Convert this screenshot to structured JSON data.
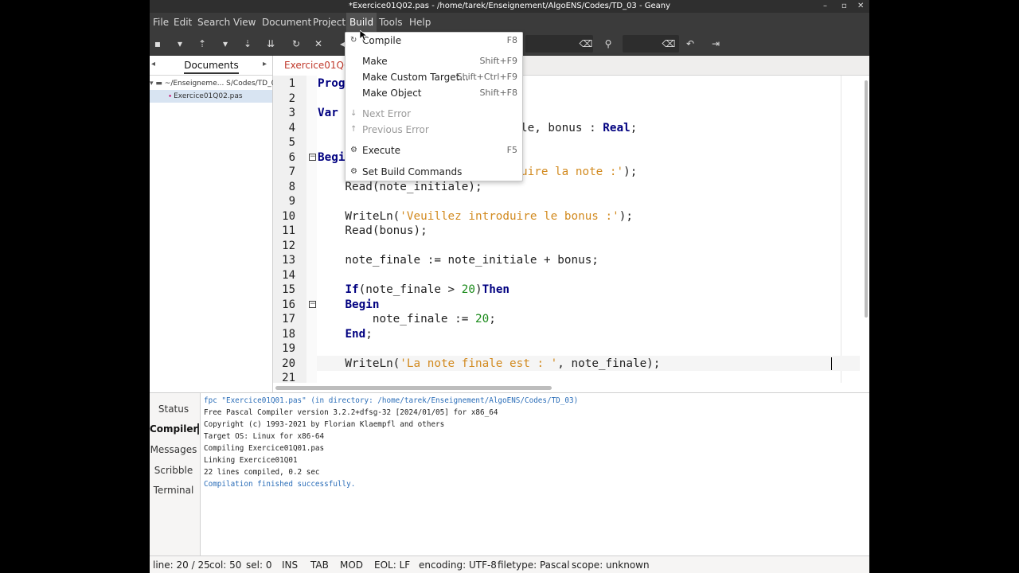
{
  "window": {
    "title": "*Exercice01Q02.pas - /home/tarek/Enseignement/AlgoENS/Codes/TD_03 - Geany",
    "controls": [
      "–",
      "▫",
      "✕"
    ]
  },
  "menubar": [
    "File",
    "Edit",
    "Search",
    "View",
    "Document",
    "Project",
    "Build",
    "Tools",
    "Help"
  ],
  "sidebar": {
    "tab_label": "Documents",
    "tree": {
      "folder": "~/Enseigneme... S/Codes/TD_03",
      "file": "Exercice01Q02.pas"
    }
  },
  "editor": {
    "tab_label": "Exercice01Q02",
    "line_numbers": [
      "1",
      "2",
      "3",
      "4",
      "5",
      "6",
      "7",
      "8",
      "9",
      "10",
      "11",
      "12",
      "13",
      "14",
      "15",
      "16",
      "17",
      "18",
      "19",
      "20",
      "21"
    ],
    "lines": {
      "l1": "Prog",
      "l3": "Var",
      "l4": "le, bonus : ",
      "l4_kw": "Real",
      "l4_end": ";",
      "l6": "Begi",
      "l7": "uire la note :'",
      "l7_end": ");",
      "l8": "    Read(note_initiale);",
      "l10_a": "    WriteLn(",
      "l10_s": "'Veuillez introduire le bonus :'",
      "l10_b": ");",
      "l11": "    Read(bonus);",
      "l13": "    note_finale := note_initiale + bonus;",
      "l15_pad": "    ",
      "l15_kw1": "If",
      "l15_a": "(note_finale > ",
      "l15_n": "20",
      "l15_b": ")",
      "l15_kw2": "Then",
      "l16_pad": "    ",
      "l16_kw": "Begin",
      "l17_a": "        note_finale := ",
      "l17_n": "20",
      "l17_b": ";",
      "l18_pad": "    ",
      "l18_kw": "End",
      "l18_b": ";",
      "l20_a": "    WriteLn(",
      "l20_s": "'La note finale est : '",
      "l20_b": ", note_finale);"
    }
  },
  "build_menu": {
    "items": [
      {
        "label": "Compile",
        "accel": "F8",
        "icon": "gear-icon"
      },
      {
        "label": "Make",
        "accel": "Shift+F9"
      },
      {
        "label": "Make Custom Target...",
        "accel": "Shift+Ctrl+F9"
      },
      {
        "label": "Make Object",
        "accel": "Shift+F8"
      },
      {
        "label": "Next Error",
        "accel": "",
        "icon": "arrow-down-icon",
        "disabled": true
      },
      {
        "label": "Previous Error",
        "accel": "",
        "icon": "arrow-up-icon",
        "disabled": true
      },
      {
        "label": "Execute",
        "accel": "F5",
        "icon": "gear-icon"
      },
      {
        "label": "Set Build Commands",
        "accel": "",
        "icon": "gear-icon"
      }
    ]
  },
  "bottom_panel": {
    "tabs": [
      "Status",
      "Compiler",
      "Messages",
      "Scribble",
      "Terminal"
    ],
    "active_tab": "Compiler",
    "output": [
      "fpc \"Exercice01Q01.pas\" (in directory: /home/tarek/Enseignement/AlgoENS/Codes/TD_03)",
      "Free Pascal Compiler version 3.2.2+dfsg-32 [2024/01/05] for x86_64",
      "Copyright (c) 1993-2021 by Florian Klaempfl and others",
      "Target OS: Linux for x86-64",
      "Compiling Exercice01Q01.pas",
      "Linking Exercice01Q01",
      "22 lines compiled, 0.2 sec",
      "Compilation finished successfully."
    ]
  },
  "statusbar": {
    "line": "line: 20 / 25",
    "col": "col: 50",
    "sel": "sel: 0",
    "ins": "INS",
    "tab": "TAB",
    "mod": "MOD",
    "eol": "EOL: LF",
    "encoding": "encoding: UTF-8",
    "filetype": "filetype: Pascal",
    "scope": "scope: unknown"
  },
  "colors": {
    "keyword": "#000080",
    "string": "#d28a1f",
    "number": "#1a8a1a",
    "output_highlight": "#2a6db8",
    "dark_chrome": "#3b3b3b"
  }
}
